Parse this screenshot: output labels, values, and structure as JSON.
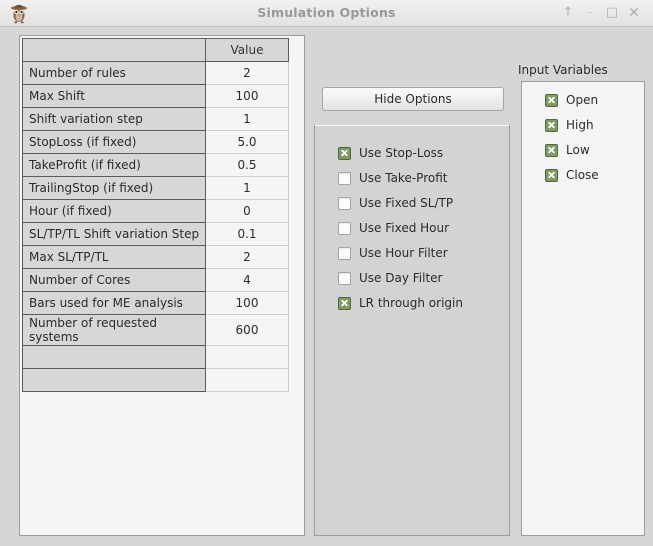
{
  "window": {
    "title": "Simulation Options",
    "icon": "owl-app-icon",
    "controls": [
      {
        "name": "shade-button",
        "glyph": "↑"
      },
      {
        "name": "minimize-button",
        "glyph": "–"
      },
      {
        "name": "maximize-button",
        "glyph": "□"
      },
      {
        "name": "close-button",
        "glyph": "✕"
      }
    ]
  },
  "options_table": {
    "headers": [
      "",
      "Value"
    ],
    "rows": [
      {
        "name": "Number of rules",
        "value": "2"
      },
      {
        "name": "Max Shift",
        "value": "100"
      },
      {
        "name": "Shift variation step",
        "value": "1"
      },
      {
        "name": "StopLoss (if fixed)",
        "value": "5.0"
      },
      {
        "name": "TakeProfit (if fixed)",
        "value": "0.5"
      },
      {
        "name": "TrailingStop (if fixed)",
        "value": "1"
      },
      {
        "name": "Hour (if fixed)",
        "value": "0"
      },
      {
        "name": "SL/TP/TL Shift variation Step",
        "value": "0.1"
      },
      {
        "name": "Max SL/TP/TL",
        "value": "2"
      },
      {
        "name": "Number of Cores",
        "value": "4"
      },
      {
        "name": "Bars used for ME analysis",
        "value": "100"
      },
      {
        "name": "Number of requested systems",
        "value": "600"
      },
      {
        "name": "",
        "value": ""
      },
      {
        "name": "",
        "value": ""
      }
    ]
  },
  "options_panel": {
    "hide_options_label": "Hide Options",
    "checkboxes": [
      {
        "label": "Use Stop-Loss",
        "checked": true
      },
      {
        "label": "Use Take-Profit",
        "checked": false
      },
      {
        "label": "Use Fixed SL/TP",
        "checked": false
      },
      {
        "label": "Use Fixed Hour",
        "checked": false
      },
      {
        "label": "Use Hour Filter",
        "checked": false
      },
      {
        "label": "Use Day Filter",
        "checked": false
      },
      {
        "label": "LR through origin",
        "checked": true
      }
    ]
  },
  "input_variables": {
    "title": "Input Variables",
    "items": [
      {
        "label": "Open",
        "checked": true
      },
      {
        "label": "High",
        "checked": true
      },
      {
        "label": "Low",
        "checked": true
      },
      {
        "label": "Close",
        "checked": true
      }
    ]
  },
  "colors": {
    "window_bg": "#d6d6d6",
    "panel_bg": "#d3d3d3",
    "field_bg": "#f5f5f5",
    "header_bg": "#d7d7d7",
    "checkbox_checked": "#7f9a63",
    "title_text": "#9a9896"
  }
}
